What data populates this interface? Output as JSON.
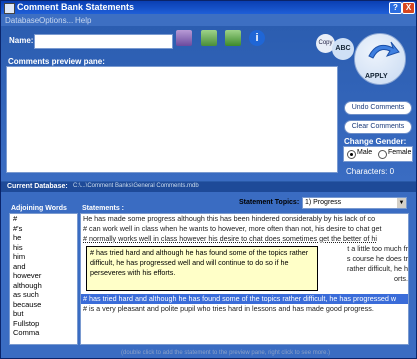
{
  "window": {
    "title": "Comment Bank Statements",
    "help_button": "?",
    "close_button": "X"
  },
  "menu": [
    "Database",
    "Options...",
    "Help"
  ],
  "name": {
    "label": "Name:",
    "value": ""
  },
  "buttons": {
    "copy": "Copy",
    "abc": "ABC",
    "apply": "APPLY",
    "undo": "Undo Comments",
    "clear": "Clear Comments"
  },
  "preview": {
    "label": "Comments preview pane:",
    "value": ""
  },
  "gender": {
    "label": "Change Gender:",
    "options": [
      "Male",
      "Female"
    ],
    "selected": "Male"
  },
  "characters": {
    "label": "Characters: 0"
  },
  "database": {
    "label": "Current Database:",
    "path": "C:\\...\\Comment Banks\\General Comments.mdb"
  },
  "topics": {
    "label": "Statement Topics:",
    "selected": "1) Progress"
  },
  "adjoining": {
    "label": "Adjoining Words",
    "items": [
      "#",
      "#'s",
      "he",
      "his",
      "him",
      "and",
      "however",
      "although",
      "as such",
      "because",
      "but",
      "Fullstop",
      "Comma"
    ]
  },
  "statements": {
    "label": "Statements :",
    "rows": [
      "He has made some progress although this has been hindered considerably by his lack of co",
      "# can work well in class when he wants to however, more often than not, his desire to chat get",
      "# normally works well in class however his desire to chat does sometimes get the better of hi",
      "",
      "",
      "",
      "",
      "",
      "# has tried hard and although he has found some of the topics rather difficult, he has progressed w",
      "# is a very pleasant and polite pupil who tries hard in lessons and has made good progress."
    ],
    "partial_right": [
      "t a little too much fr",
      "s course he does tr",
      "rather difficult, he h",
      "orts."
    ],
    "selected_index": 8
  },
  "tooltip": "# has tried hard and although he has found some of the topics rather difficult, he has progressed well and will continue to do so if he perseveres with his efforts.",
  "status": "(double click to add the statement to the preview pane, right click to see more.)"
}
